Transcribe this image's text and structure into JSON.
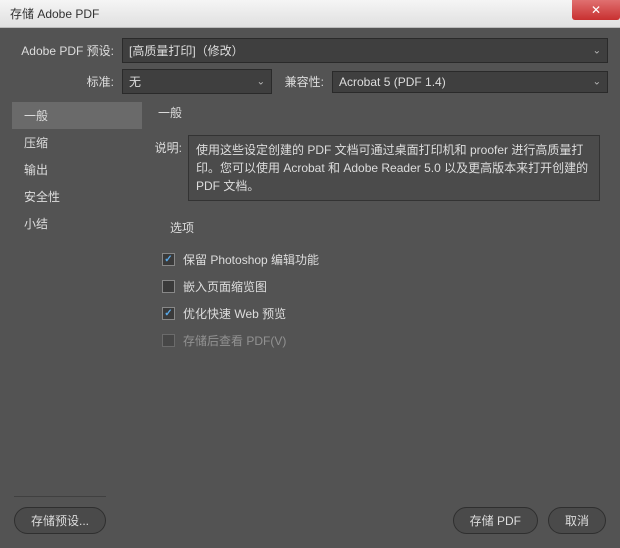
{
  "window": {
    "title": "存储 Adobe PDF"
  },
  "header": {
    "preset_label": "Adobe PDF 预设:",
    "preset_value": "[高质量打印]（修改）",
    "standard_label": "标准:",
    "standard_value": "无",
    "compat_label": "兼容性:",
    "compat_value": "Acrobat 5 (PDF 1.4)"
  },
  "sidebar": {
    "items": [
      {
        "label": "一般",
        "active": true
      },
      {
        "label": "压缩",
        "active": false
      },
      {
        "label": "输出",
        "active": false
      },
      {
        "label": "安全性",
        "active": false
      },
      {
        "label": "小结",
        "active": false
      }
    ]
  },
  "panel": {
    "title": "一般",
    "desc_label": "说明:",
    "description": "使用这些设定创建的 PDF 文档可通过桌面打印机和 proofer 进行高质量打印。您可以使用 Acrobat 和 Adobe Reader 5.0 以及更高版本来打开创建的 PDF 文档。",
    "options_label": "选项",
    "options": [
      {
        "label": "保留 Photoshop 编辑功能",
        "checked": true,
        "disabled": false
      },
      {
        "label": "嵌入页面缩览图",
        "checked": false,
        "disabled": false
      },
      {
        "label": "优化快速 Web 预览",
        "checked": true,
        "disabled": false
      },
      {
        "label": "存储后查看 PDF(V)",
        "checked": false,
        "disabled": true
      }
    ]
  },
  "footer": {
    "save_preset": "存储预设...",
    "save_pdf": "存储 PDF",
    "cancel": "取消"
  }
}
